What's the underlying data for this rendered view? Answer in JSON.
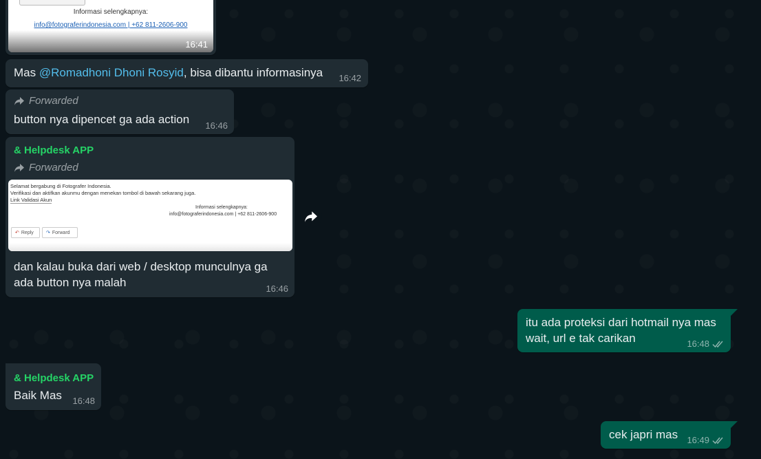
{
  "messages": {
    "m1": {
      "info_label": "Informasi selengkapnya:",
      "info_links": "info@fotograferindonesia.com | +62 811-2606-900",
      "time": "16:41"
    },
    "m2": {
      "prefix": "Mas ",
      "mention": "@Romadhoni Dhoni Rosyid",
      "suffix": ", bisa dibantu informasinya",
      "time": "16:42"
    },
    "m3": {
      "forwarded": "Forwarded",
      "text": "button nya dipencet ga ada action",
      "time": "16:46"
    },
    "m4": {
      "sender": "& Helpdesk APP",
      "forwarded": "Forwarded",
      "preview_line1": "Selamat bergabung di Fotografer Indonesia.",
      "preview_line2": "Verifikasi dan aktifkan akunmu dengan menekan tombol di bawah sekarang juga.",
      "preview_link": "Link Validasi Akun",
      "preview_info": "Informasi selengkapnya:",
      "preview_contact": "info@fotograferindonesia.com | +62 811-2606-900",
      "preview_reply": "Reply",
      "preview_forward": "Forward",
      "text_line1": "dan kalau buka dari web / desktop munculnya ga",
      "text_line2": "ada button nya malah",
      "time": "16:46"
    },
    "m5": {
      "text_line1": "itu ada proteksi dari hotmail nya mas",
      "text_line2": "wait, url e tak carikan",
      "time": "16:48"
    },
    "m6": {
      "sender": "& Helpdesk APP",
      "text": "Baik Mas",
      "time": "16:48"
    },
    "m7": {
      "text": "cek japri mas",
      "time": "16:49"
    }
  },
  "colors": {
    "background": "#0b141a",
    "incoming": "#202c33",
    "outgoing": "#005c4b",
    "sender_name": "#25d366",
    "mention": "#53bdeb"
  }
}
